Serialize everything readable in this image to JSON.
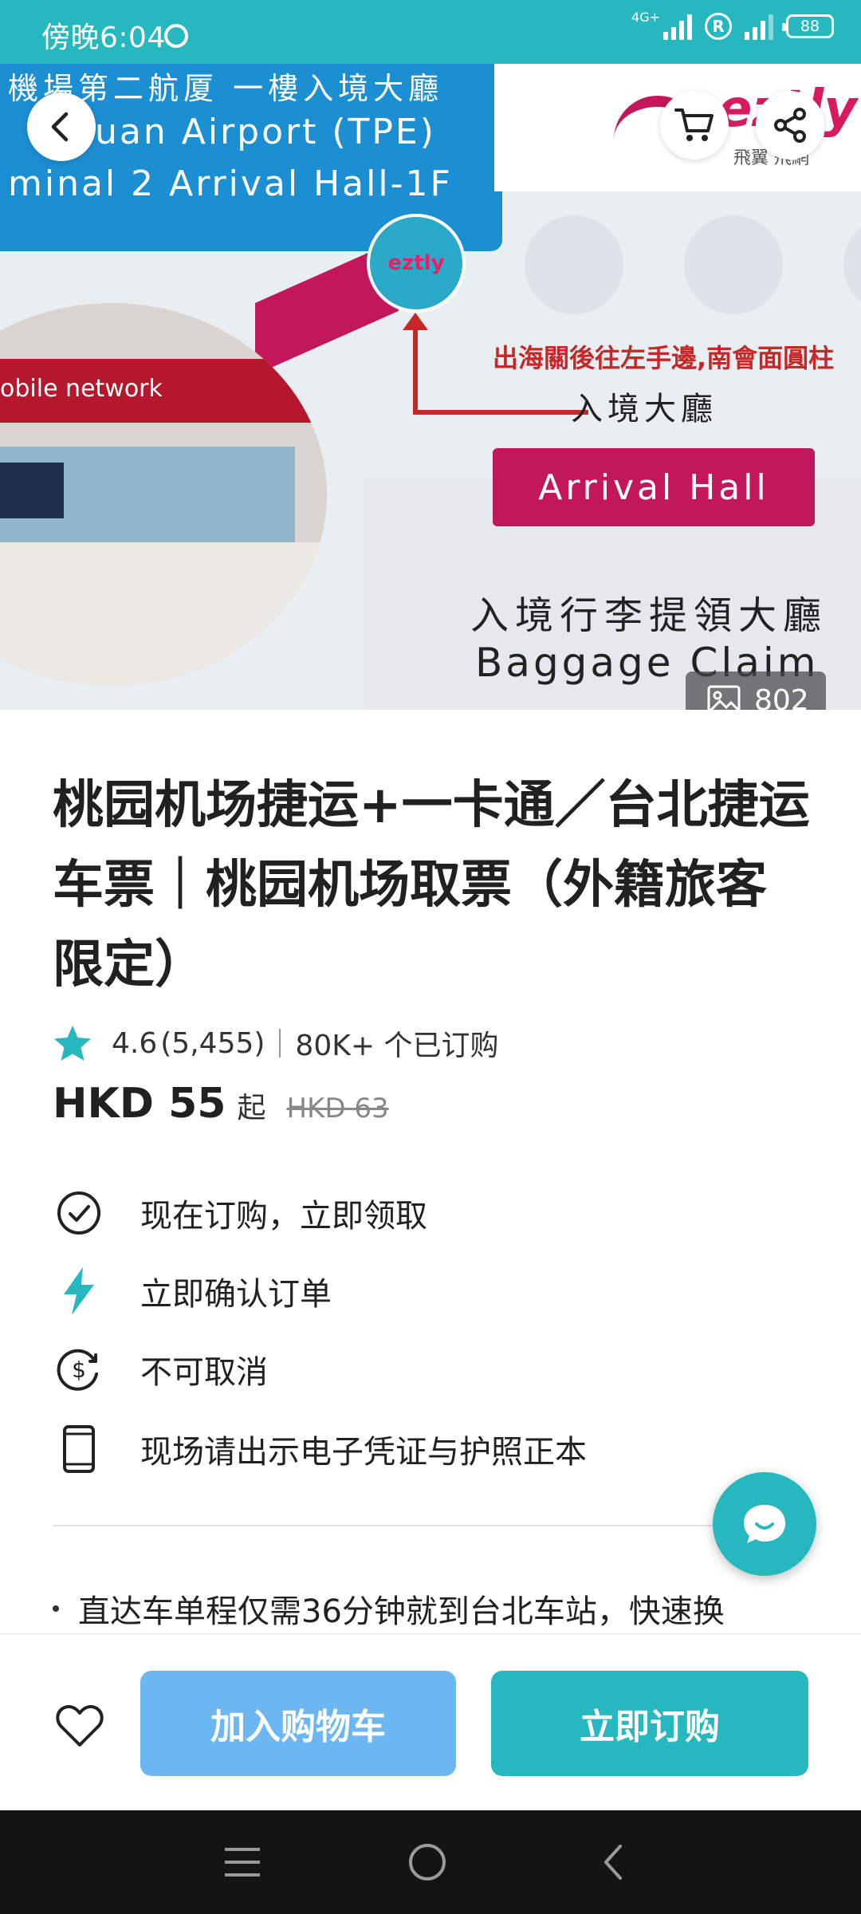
{
  "status_bar": {
    "time": "傍晚6:04",
    "network": "4G+",
    "registered": "R",
    "battery": "88"
  },
  "hero": {
    "photo_count": "802",
    "slide_count": 3,
    "active_slide": 2,
    "sign": {
      "line1": "機場第二航厦 一樓入境大廳",
      "line2": "yuan Airport (TPE)",
      "line3": "minal 2 Arrival Hall-1F"
    },
    "brand_text": "eztly",
    "brand_cn": "飛翼  飛網",
    "logo_text": "eztly",
    "photo_banner": "obile network",
    "direction_text": "出海關後往左手邊,南會面圓柱",
    "hall_cn": "入境大廳",
    "arrival_hall": "Arrival Hall",
    "baggage_cn": "入境行李提領大廳",
    "baggage_en": "Baggage Claim"
  },
  "product": {
    "title": "桃园机场捷运+一卡通／台北捷运车票｜桃园机场取票（外籍旅客限定）",
    "rating": "4.6",
    "review_count": "(5,455)",
    "booked": "80K+ 个已订购",
    "price": "HKD 55",
    "price_suffix": "起",
    "original_price": "HKD 63"
  },
  "features": [
    {
      "icon": "check-circle-icon",
      "text": "现在订购，立即领取"
    },
    {
      "icon": "lightning-icon",
      "text": "立即确认订单"
    },
    {
      "icon": "no-refund-icon",
      "text": "不可取消"
    },
    {
      "icon": "phone-icon",
      "text": "现场请出示电子凭证与护照正本"
    }
  ],
  "description_preview": "直达车单程仅需36分钟就到台北车站，快速换",
  "actions": {
    "add_to_cart": "加入购物车",
    "book_now": "立即订购"
  },
  "colors": {
    "brand_teal": "#26b7bf",
    "cart_blue": "#6cb7f2",
    "star": "#26b7bf"
  }
}
